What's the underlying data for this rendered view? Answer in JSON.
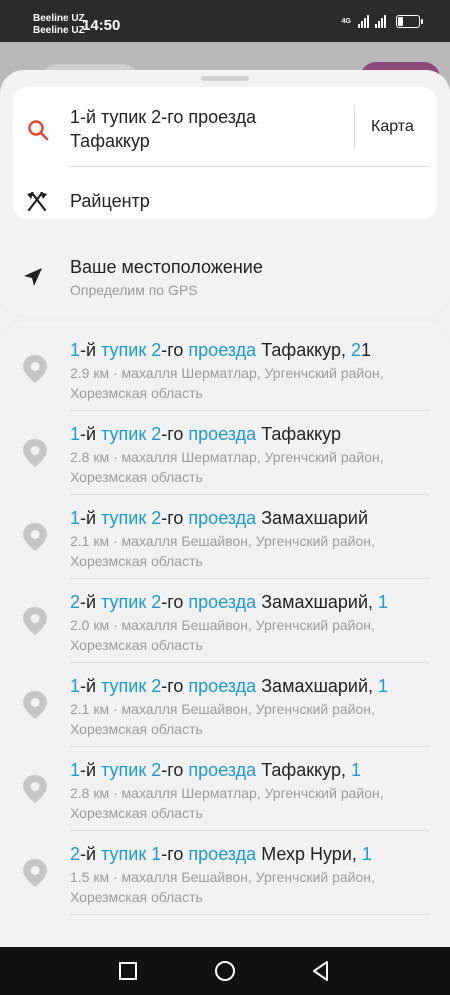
{
  "status_bar": {
    "carrier1": "Beeline UZ",
    "carrier2": "Beeline UZ",
    "time": "14:50",
    "network": "4G"
  },
  "search": {
    "query": "1-й тупик 2-го проезда Тафаккур",
    "map_button": "Карта",
    "destination": "Райцентр"
  },
  "location": {
    "title": "Ваше местоположение",
    "subtitle": "Определим по GPS"
  },
  "results": [
    {
      "title": [
        {
          "t": "1",
          "h": true
        },
        {
          "t": "-й ",
          "h": false
        },
        {
          "t": "тупик",
          "h": true
        },
        {
          "t": " ",
          "h": false
        },
        {
          "t": "2",
          "h": true
        },
        {
          "t": "-го ",
          "h": false
        },
        {
          "t": "проезда",
          "h": true
        },
        {
          "t": " Тафаккур, ",
          "h": false
        },
        {
          "t": "2",
          "h": true
        },
        {
          "t": "1",
          "h": false
        }
      ],
      "subtitle": "2.9 км · махалля Шерматлар, Ургенчский район, Хорезмская область"
    },
    {
      "title": [
        {
          "t": "1",
          "h": true
        },
        {
          "t": "-й ",
          "h": false
        },
        {
          "t": "тупик",
          "h": true
        },
        {
          "t": " ",
          "h": false
        },
        {
          "t": "2",
          "h": true
        },
        {
          "t": "-го ",
          "h": false
        },
        {
          "t": "проезда",
          "h": true
        },
        {
          "t": " Тафаккур",
          "h": false
        }
      ],
      "subtitle": "2.8 км · махалля Шерматлар, Ургенчский район, Хорезмская область"
    },
    {
      "title": [
        {
          "t": "1",
          "h": true
        },
        {
          "t": "-й ",
          "h": false
        },
        {
          "t": "тупик",
          "h": true
        },
        {
          "t": " ",
          "h": false
        },
        {
          "t": "2",
          "h": true
        },
        {
          "t": "-го ",
          "h": false
        },
        {
          "t": "проезда",
          "h": true
        },
        {
          "t": " Замахшарий",
          "h": false
        }
      ],
      "subtitle": "2.1 км · махалля Бешайвон, Ургенчский район, Хорезмская область"
    },
    {
      "title": [
        {
          "t": "2",
          "h": true
        },
        {
          "t": "-й ",
          "h": false
        },
        {
          "t": "тупик",
          "h": true
        },
        {
          "t": " ",
          "h": false
        },
        {
          "t": "2",
          "h": true
        },
        {
          "t": "-го ",
          "h": false
        },
        {
          "t": "проезда",
          "h": true
        },
        {
          "t": " Замахшарий, ",
          "h": false
        },
        {
          "t": "1",
          "h": true
        }
      ],
      "subtitle": "2.0 км · махалля Бешайвон, Ургенчский район, Хорезмская область"
    },
    {
      "title": [
        {
          "t": "1",
          "h": true
        },
        {
          "t": "-й ",
          "h": false
        },
        {
          "t": "тупик",
          "h": true
        },
        {
          "t": " ",
          "h": false
        },
        {
          "t": "2",
          "h": true
        },
        {
          "t": "-го ",
          "h": false
        },
        {
          "t": "проезда",
          "h": true
        },
        {
          "t": " Замахшарий, ",
          "h": false
        },
        {
          "t": "1",
          "h": true
        }
      ],
      "subtitle": "2.1 км · махалля Бешайвон, Ургенчский район, Хорезмская область"
    },
    {
      "title": [
        {
          "t": "1",
          "h": true
        },
        {
          "t": "-й ",
          "h": false
        },
        {
          "t": "тупик",
          "h": true
        },
        {
          "t": " ",
          "h": false
        },
        {
          "t": "2",
          "h": true
        },
        {
          "t": "-го ",
          "h": false
        },
        {
          "t": "проезда",
          "h": true
        },
        {
          "t": " Тафаккур, ",
          "h": false
        },
        {
          "t": "1",
          "h": true
        }
      ],
      "subtitle": "2.8 км · махалля Шерматлар, Ургенчский район, Хорезмская область"
    },
    {
      "title": [
        {
          "t": "2",
          "h": true
        },
        {
          "t": "-й ",
          "h": false
        },
        {
          "t": "тупик",
          "h": true
        },
        {
          "t": " ",
          "h": false
        },
        {
          "t": "1",
          "h": true
        },
        {
          "t": "-го ",
          "h": false
        },
        {
          "t": "проезда",
          "h": true
        },
        {
          "t": " Мехр Нури, ",
          "h": false
        },
        {
          "t": "1",
          "h": true
        }
      ],
      "subtitle": "1.5 км · махалля Бешайвон, Ургенчский район, Хорезмская область"
    }
  ],
  "colors": {
    "highlight": "#1a9ad6",
    "search_icon": "#e8432d",
    "pin": "#c6c6c6"
  },
  "icons": {
    "search": "search-icon",
    "route": "crossed-flags-icon",
    "location": "location-arrow-icon",
    "pin": "map-pin-icon",
    "nav_recent": "square-icon",
    "nav_home": "circle-icon",
    "nav_back": "triangle-back-icon"
  }
}
